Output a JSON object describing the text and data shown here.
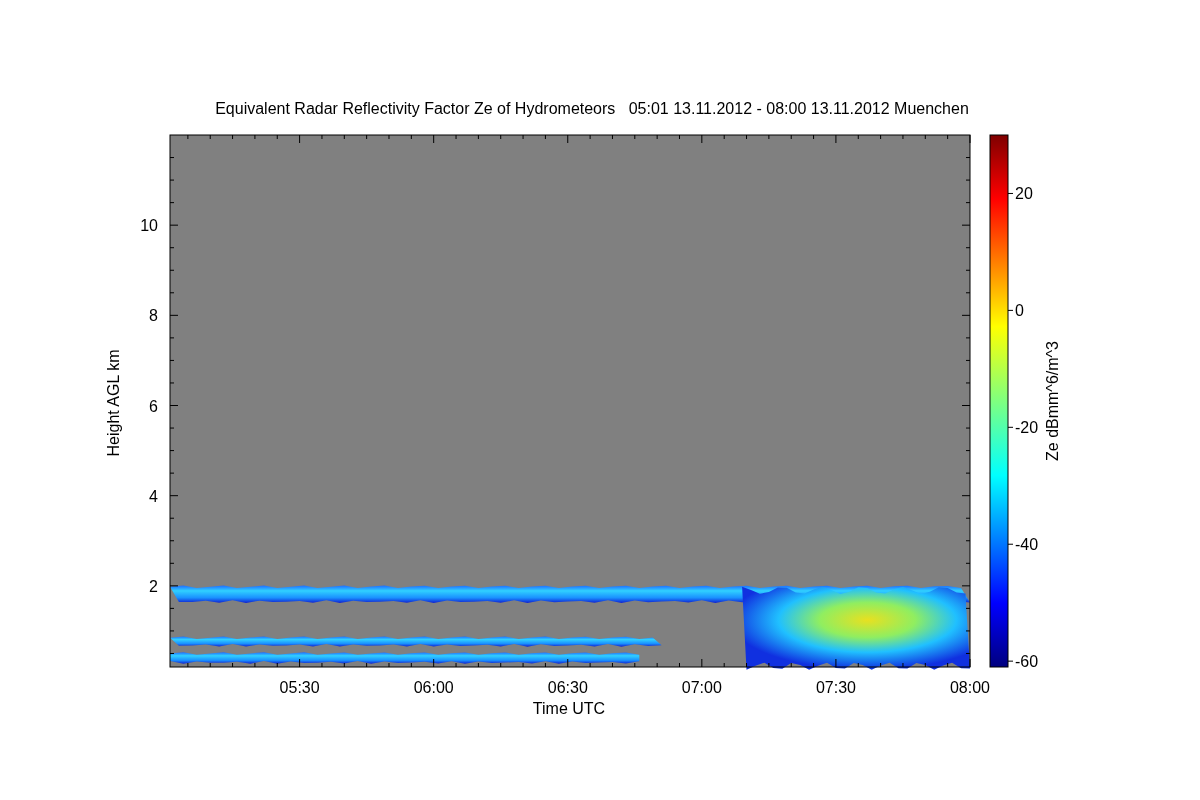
{
  "title": "Equivalent Radar Reflectivity Factor Ze of Hydrometeors   05:01 13.11.2012 - 08:00 13.11.2012 Muenchen",
  "plot": {
    "ylabel": "Height AGL km",
    "xlabel": "Time UTC",
    "yticks": [
      "10",
      "8",
      "6",
      "4",
      "2"
    ],
    "xticks": [
      "05:30",
      "06:00",
      "06:30",
      "07:00",
      "07:30",
      "08:00"
    ]
  },
  "colorbar": {
    "label": "Ze dBmm^6/m^3",
    "ticks": [
      "20",
      "0",
      "-20",
      "-40",
      "-60"
    ]
  }
}
